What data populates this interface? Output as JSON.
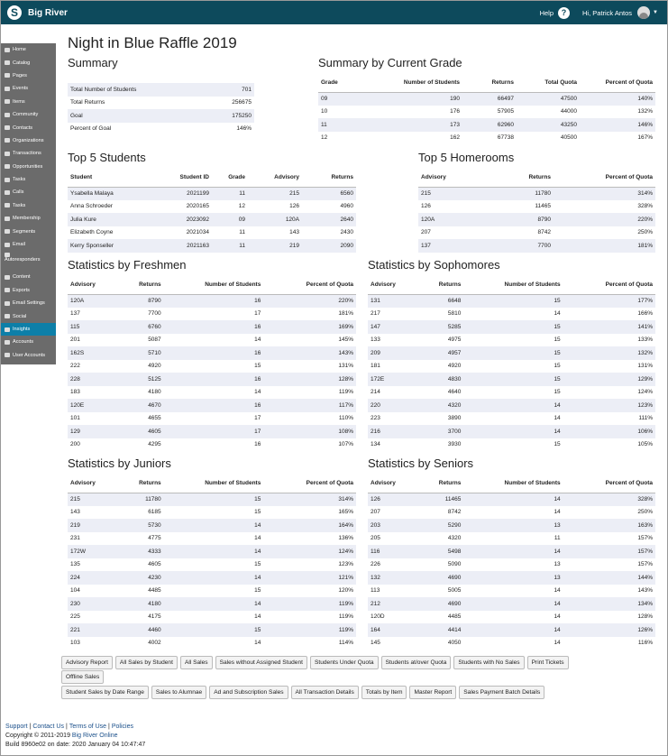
{
  "app": {
    "name": "Big River",
    "help": "Help",
    "user": "Hi, Patrick Antos"
  },
  "sidebar": [
    "Home",
    "Catalog",
    "Pages",
    "Events",
    "Items",
    "Community",
    "Contacts",
    "Organizations",
    "Transactions",
    "Opportunities",
    "Tasks",
    "Calls",
    "Tasks",
    "Membership",
    "Segments",
    "Email",
    "Autoresponders",
    "Content",
    "Exports",
    "Email Settings",
    "Social",
    "Insights",
    "Accounts",
    "User Accounts"
  ],
  "title": "Night in Blue Raffle 2019",
  "summary": {
    "heading": "Summary",
    "rows": [
      [
        "Total Number of Students",
        "701"
      ],
      [
        "Total Returns",
        "256675"
      ],
      [
        "Goal",
        "175250"
      ],
      [
        "Percent of Goal",
        "146%"
      ]
    ]
  },
  "by_grade": {
    "heading": "Summary by Current Grade",
    "cols": [
      "Grade",
      "Number of Students",
      "Returns",
      "Total Quota",
      "Percent of Quota"
    ],
    "rows": [
      [
        "09",
        "190",
        "66497",
        "47500",
        "140%"
      ],
      [
        "10",
        "176",
        "57905",
        "44000",
        "132%"
      ],
      [
        "11",
        "173",
        "62960",
        "43250",
        "146%"
      ],
      [
        "12",
        "162",
        "67738",
        "40500",
        "167%"
      ]
    ]
  },
  "top_students": {
    "heading": "Top 5 Students",
    "cols": [
      "Student",
      "Student ID",
      "Grade",
      "Advisory",
      "Returns"
    ],
    "rows": [
      [
        "Ysabella Malaya",
        "2021199",
        "11",
        "215",
        "6560"
      ],
      [
        "Anna Schroeder",
        "2020165",
        "12",
        "126",
        "4960"
      ],
      [
        "Julia Kure",
        "2023092",
        "09",
        "120A",
        "2640"
      ],
      [
        "Elizabeth Coyne",
        "2021034",
        "11",
        "143",
        "2430"
      ],
      [
        "Kerry Sponseller",
        "2021163",
        "11",
        "219",
        "2090"
      ]
    ]
  },
  "top_homerooms": {
    "heading": "Top 5 Homerooms",
    "cols": [
      "Advisory",
      "Returns",
      "Percent of Quota"
    ],
    "rows": [
      [
        "215",
        "11780",
        "314%"
      ],
      [
        "126",
        "11465",
        "328%"
      ],
      [
        "120A",
        "8790",
        "220%"
      ],
      [
        "207",
        "8742",
        "250%"
      ],
      [
        "137",
        "7700",
        "181%"
      ]
    ]
  },
  "stat_cols": [
    "Advisory",
    "Returns",
    "Number of Students",
    "Percent of Quota"
  ],
  "freshmen": {
    "heading": "Statistics by Freshmen",
    "rows": [
      [
        "120A",
        "8790",
        "16",
        "220%"
      ],
      [
        "137",
        "7700",
        "17",
        "181%"
      ],
      [
        "115",
        "6760",
        "16",
        "169%"
      ],
      [
        "201",
        "5087",
        "14",
        "145%"
      ],
      [
        "162S",
        "5710",
        "16",
        "143%"
      ],
      [
        "222",
        "4920",
        "15",
        "131%"
      ],
      [
        "228",
        "5125",
        "16",
        "128%"
      ],
      [
        "183",
        "4180",
        "14",
        "119%"
      ],
      [
        "120E",
        "4670",
        "16",
        "117%"
      ],
      [
        "101",
        "4655",
        "17",
        "110%"
      ],
      [
        "129",
        "4605",
        "17",
        "108%"
      ],
      [
        "200",
        "4295",
        "16",
        "107%"
      ]
    ]
  },
  "sophomores": {
    "heading": "Statistics by Sophomores",
    "rows": [
      [
        "131",
        "6648",
        "15",
        "177%"
      ],
      [
        "217",
        "5810",
        "14",
        "166%"
      ],
      [
        "147",
        "5285",
        "15",
        "141%"
      ],
      [
        "133",
        "4975",
        "15",
        "133%"
      ],
      [
        "209",
        "4957",
        "15",
        "132%"
      ],
      [
        "181",
        "4920",
        "15",
        "131%"
      ],
      [
        "172E",
        "4830",
        "15",
        "129%"
      ],
      [
        "214",
        "4640",
        "15",
        "124%"
      ],
      [
        "220",
        "4320",
        "14",
        "123%"
      ],
      [
        "223",
        "3890",
        "14",
        "111%"
      ],
      [
        "216",
        "3700",
        "14",
        "106%"
      ],
      [
        "134",
        "3930",
        "15",
        "105%"
      ]
    ]
  },
  "juniors": {
    "heading": "Statistics by Juniors",
    "rows": [
      [
        "215",
        "11780",
        "15",
        "314%"
      ],
      [
        "143",
        "6185",
        "15",
        "165%"
      ],
      [
        "219",
        "5730",
        "14",
        "164%"
      ],
      [
        "231",
        "4775",
        "14",
        "136%"
      ],
      [
        "172W",
        "4333",
        "14",
        "124%"
      ],
      [
        "135",
        "4605",
        "15",
        "123%"
      ],
      [
        "224",
        "4230",
        "14",
        "121%"
      ],
      [
        "104",
        "4485",
        "15",
        "120%"
      ],
      [
        "230",
        "4180",
        "14",
        "119%"
      ],
      [
        "225",
        "4175",
        "14",
        "119%"
      ],
      [
        "221",
        "4460",
        "15",
        "119%"
      ],
      [
        "103",
        "4002",
        "14",
        "114%"
      ]
    ]
  },
  "seniors": {
    "heading": "Statistics by Seniors",
    "rows": [
      [
        "126",
        "11465",
        "14",
        "328%"
      ],
      [
        "207",
        "8742",
        "14",
        "250%"
      ],
      [
        "203",
        "5290",
        "13",
        "163%"
      ],
      [
        "205",
        "4320",
        "11",
        "157%"
      ],
      [
        "116",
        "5498",
        "14",
        "157%"
      ],
      [
        "226",
        "5090",
        "13",
        "157%"
      ],
      [
        "132",
        "4690",
        "13",
        "144%"
      ],
      [
        "113",
        "5005",
        "14",
        "143%"
      ],
      [
        "212",
        "4690",
        "14",
        "134%"
      ],
      [
        "120D",
        "4485",
        "14",
        "128%"
      ],
      [
        "164",
        "4414",
        "14",
        "126%"
      ],
      [
        "145",
        "4050",
        "14",
        "116%"
      ]
    ]
  },
  "buttons_row1": [
    "Advisory Report",
    "All Sales by Student",
    "All Sales",
    "Sales without Assigned Student",
    "Students Under Quota",
    "Students at/over Quota",
    "Students with No Sales",
    "Print Tickets"
  ],
  "buttons_row2": [
    "Offline Sales"
  ],
  "buttons_row3": [
    "Student Sales by Date Range",
    "Sales to Alumnae",
    "Ad and Subscription Sales",
    "All Transaction Details",
    "Totals by Item",
    "Master Report",
    "Sales Payment Batch Details"
  ],
  "footer": {
    "links": [
      "Support",
      "Contact Us",
      "Terms of Use",
      "Policies"
    ],
    "copyright_prefix": "Copyright © 2011-2019 ",
    "brand": "Big River Online",
    "build": "Build 8960e02 on date: 2020 January 04 10:47:47"
  }
}
